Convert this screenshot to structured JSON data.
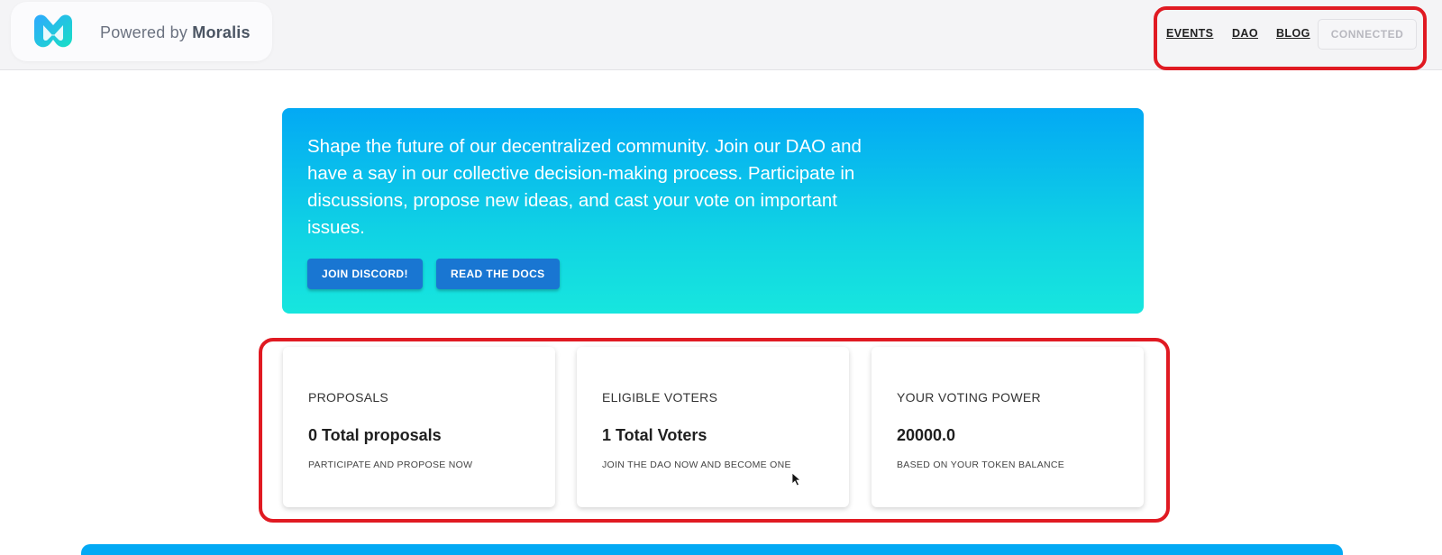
{
  "header": {
    "brand": {
      "prefix": "Powered by",
      "name": "Moralis",
      "icon": "moralis-logo-icon"
    },
    "nav": [
      {
        "label": "EVENTS"
      },
      {
        "label": "DAO"
      },
      {
        "label": "BLOG"
      }
    ],
    "connect_button": "CONNECTED"
  },
  "hero": {
    "text": "Shape the future of our decentralized community. Join our DAO and have a say in our collective decision-making process. Participate in discussions, propose new ideas, and cast your vote on important issues.",
    "buttons": [
      {
        "label": "JOIN DISCORD!"
      },
      {
        "label": "READ THE DOCS"
      }
    ]
  },
  "stats": [
    {
      "title": "PROPOSALS",
      "value": "0 Total proposals",
      "subtitle": "PARTICIPATE AND PROPOSE NOW"
    },
    {
      "title": "ELIGIBLE VOTERS",
      "value": "1 Total Voters",
      "subtitle": "JOIN THE DAO NOW AND BECOME ONE"
    },
    {
      "title": "YOUR VOTING POWER",
      "value": "20000.0",
      "subtitle": "BASED ON YOUR TOKEN BALANCE"
    }
  ],
  "colors": {
    "accent": "#1976d2",
    "hero_gradient_start": "#03a9f4",
    "hero_gradient_end": "#17e6de",
    "highlight": "#e01a22"
  }
}
